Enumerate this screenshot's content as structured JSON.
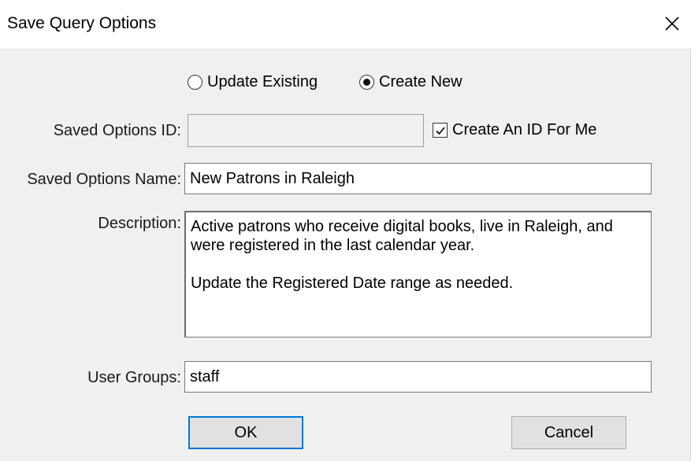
{
  "window": {
    "title": "Save Query Options"
  },
  "mode": {
    "options": [
      {
        "label": "Update Existing",
        "selected": false
      },
      {
        "label": "Create New",
        "selected": true
      }
    ]
  },
  "saved_id": {
    "label": "Saved Options ID:",
    "value": "",
    "disabled": true,
    "auto_id": {
      "label": "Create An ID For Me",
      "checked": true
    }
  },
  "saved_name": {
    "label": "Saved Options Name:",
    "value": "New Patrons in Raleigh"
  },
  "description": {
    "label": "Description:",
    "value": "Active patrons who receive digital books, live in Raleigh, and were registered in the last calendar year.\n\nUpdate the Registered Date range as needed."
  },
  "user_groups": {
    "label": "User Groups:",
    "value": "staff"
  },
  "buttons": {
    "ok": "OK",
    "cancel": "Cancel"
  },
  "colors": {
    "dialog_bg": "#f0f0f0",
    "focus_border": "#0078d7",
    "button_bg": "#e1e1e1"
  }
}
